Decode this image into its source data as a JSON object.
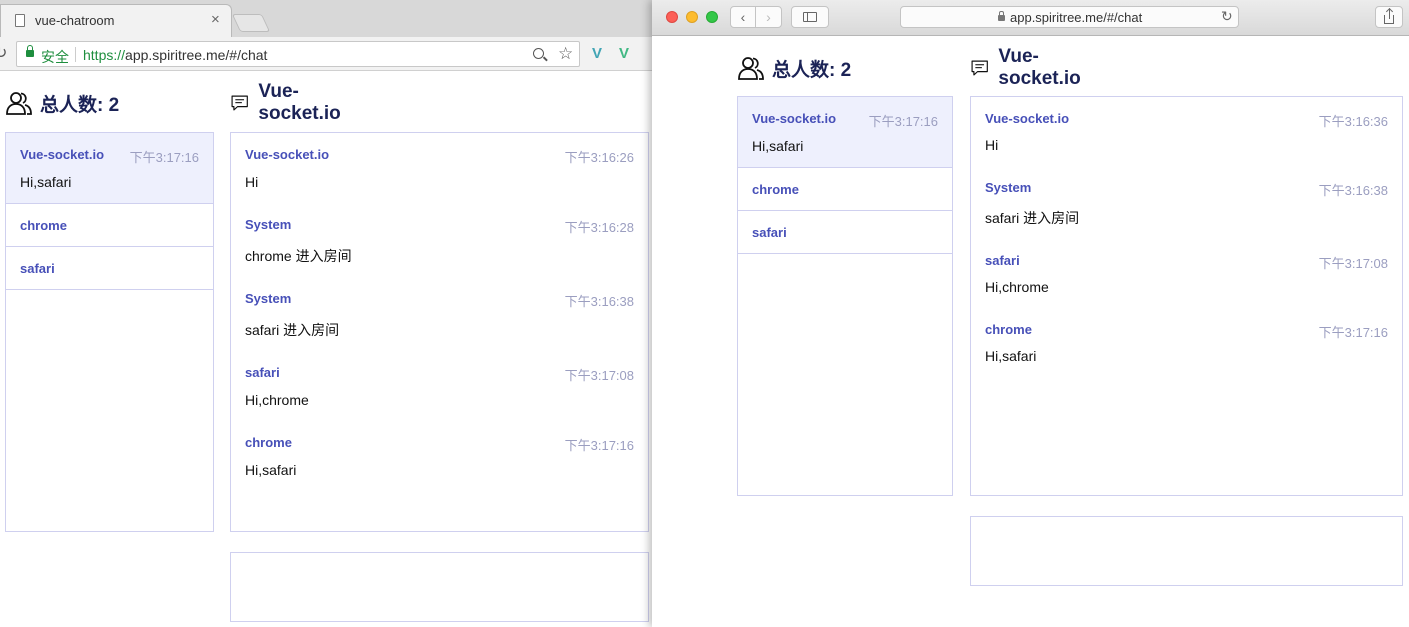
{
  "chrome": {
    "tab_title": "vue-chatroom",
    "tab_close": "×",
    "reload": "↻",
    "secure_label": "安全",
    "url_scheme": "https://",
    "url_rest": "app.spiritree.me/#/chat",
    "star": "☆",
    "ext1": "V",
    "ext2": "V",
    "app": {
      "users_title": "总人数: 2",
      "chat_title": "Vue-socket.io",
      "users": [
        {
          "name": "Vue-socket.io",
          "time": "下午3:17:16",
          "message": "Hi,safari"
        },
        {
          "name": "chrome"
        },
        {
          "name": "safari"
        }
      ],
      "messages": [
        {
          "name": "Vue-socket.io",
          "time": "下午3:16:26",
          "text": "Hi"
        },
        {
          "name": "System",
          "time": "下午3:16:28",
          "text": "chrome 进入房间"
        },
        {
          "name": "System",
          "time": "下午3:16:38",
          "text": "safari 进入房间"
        },
        {
          "name": "safari",
          "time": "下午3:17:08",
          "text": "Hi,chrome"
        },
        {
          "name": "chrome",
          "time": "下午3:17:16",
          "text": "Hi,safari"
        }
      ]
    }
  },
  "safari": {
    "back": "‹",
    "forward": "›",
    "url": "app.spiritree.me/#/chat",
    "reload": "↻",
    "app": {
      "users_title": "总人数: 2",
      "chat_title": "Vue-socket.io",
      "users": [
        {
          "name": "Vue-socket.io",
          "time": "下午3:17:16",
          "message": "Hi,safari"
        },
        {
          "name": "chrome"
        },
        {
          "name": "safari"
        }
      ],
      "messages": [
        {
          "name": "Vue-socket.io",
          "time": "下午3:16:36",
          "text": "Hi"
        },
        {
          "name": "System",
          "time": "下午3:16:38",
          "text": "safari 进入房间"
        },
        {
          "name": "safari",
          "time": "下午3:17:08",
          "text": "Hi,chrome"
        },
        {
          "name": "chrome",
          "time": "下午3:17:16",
          "text": "Hi,safari"
        }
      ]
    }
  },
  "colors": {
    "title": "#1b2356",
    "username": "#4750b8",
    "timestamp": "#9b9ec0",
    "active_user_bg": "#eef0fd",
    "border": "#cfd0ef"
  }
}
